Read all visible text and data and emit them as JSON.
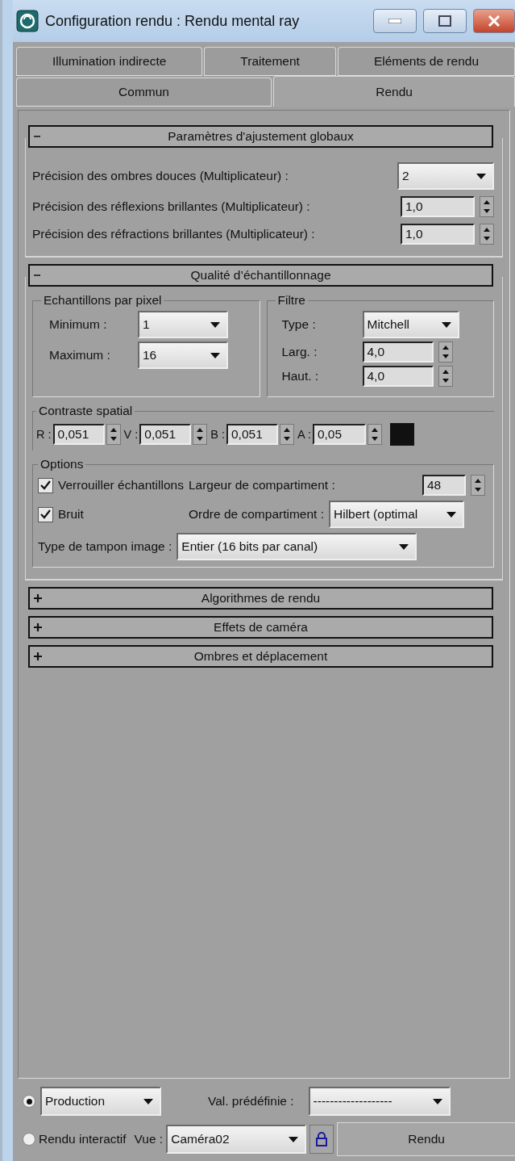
{
  "window": {
    "title": "Configuration rendu : Rendu mental ray"
  },
  "tab_rows": [
    [
      {
        "label": "Illumination indirecte",
        "selected": false
      },
      {
        "label": "Traitement",
        "selected": false
      },
      {
        "label": "Eléments de rendu",
        "selected": false
      }
    ],
    [
      {
        "label": "Commun",
        "selected": false
      },
      {
        "label": "Rendu",
        "selected": true
      }
    ]
  ],
  "rollouts": [
    {
      "title": "Paramètres d'ajustement globaux",
      "expanded": true,
      "kind": "global",
      "rows": [
        {
          "kind": "dropdown",
          "label": "Précision des ombres douces (Multiplicateur) :",
          "value": "2"
        },
        {
          "kind": "spinner",
          "label": "Précision des réflexions brillantes (Multiplicateur) :",
          "value": "1,0"
        },
        {
          "kind": "spinner",
          "label": "Précision des réfractions brillantes (Multiplicateur) :",
          "value": "1,0"
        }
      ]
    },
    {
      "title": "Qualité d’échantillonnage",
      "expanded": true,
      "kind": "sampling",
      "samples": {
        "title": "Echantillons par pixel",
        "rows": [
          {
            "label": "Minimum :",
            "value": "1"
          },
          {
            "label": "Maximum :",
            "value": "16"
          }
        ]
      },
      "filter": {
        "title": "Filtre",
        "type_label": "Type :",
        "type_value": "Mitchell",
        "rows": [
          {
            "label": "Larg. :",
            "value": "4,0"
          },
          {
            "label": "Haut. :",
            "value": "4,0"
          }
        ]
      },
      "contrast": {
        "title": "Contraste spatial",
        "channels": [
          {
            "label": "R :",
            "value": "0,051"
          },
          {
            "label": "V :",
            "value": "0,051"
          },
          {
            "label": "B :",
            "value": "0,051"
          },
          {
            "label": "A :",
            "value": "0,05"
          }
        ],
        "color": "#111111"
      },
      "options": {
        "title": "Options",
        "lock": {
          "label": "Verrouiller échantillons",
          "checked": true
        },
        "bucket_width": {
          "label": "Largeur de compartiment :",
          "value": "48"
        },
        "noise": {
          "label": "Bruit",
          "checked": true
        },
        "bucket_order": {
          "label": "Ordre de compartiment :",
          "value": "Hilbert (optimal"
        },
        "buffer": {
          "label": "Type de tampon image :",
          "value": "Entier (16 bits par canal)"
        }
      }
    },
    {
      "title": "Algorithmes de rendu",
      "expanded": false
    },
    {
      "title": "Effets de caméra",
      "expanded": false
    },
    {
      "title": "Ombres et déplacement",
      "expanded": false
    }
  ],
  "footer": {
    "modes": [
      {
        "selected": true,
        "value": "Production"
      },
      {
        "selected": false,
        "label": "Rendu interactif"
      }
    ],
    "preset": {
      "label": "Val. prédéfinie :",
      "value": "-------------------"
    },
    "view": {
      "label": "Vue :",
      "value": "Caméra02"
    },
    "render_button": "Rendu"
  }
}
